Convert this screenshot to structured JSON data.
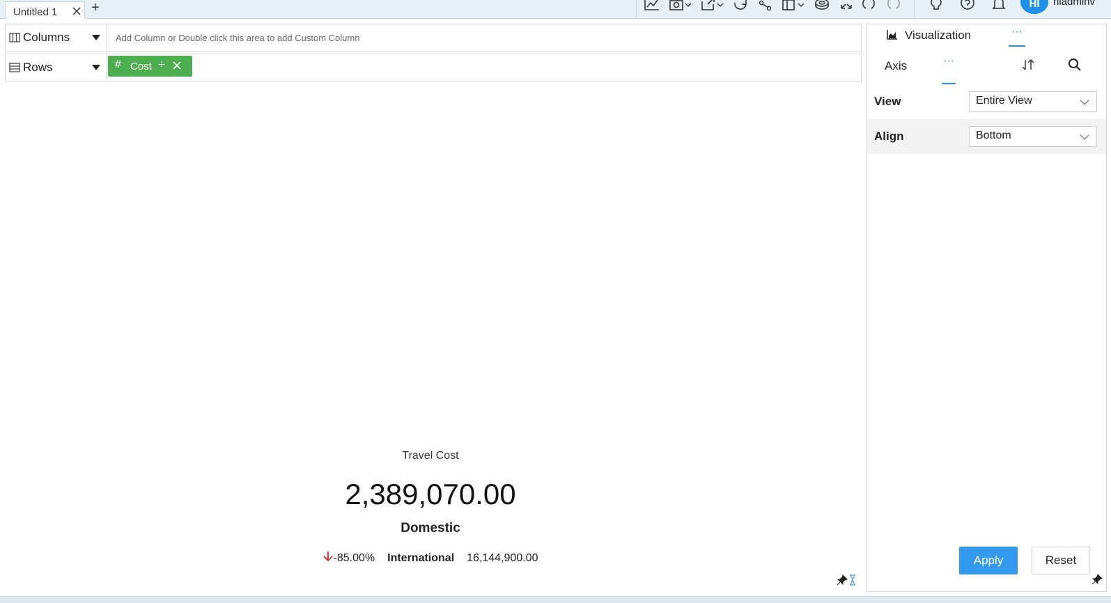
{
  "tabs": [
    {
      "title": "Untitled 1"
    }
  ],
  "tab_add_label": "+",
  "toolbar": {
    "icons": [
      "chart-icon",
      "camera-icon",
      "export-icon",
      "refresh-icon",
      "share-icon",
      "layout-icon",
      "database-icon",
      "expand-icon",
      "undo-icon",
      "redo-icon",
      "bulb-icon",
      "help-icon",
      "bell-icon"
    ]
  },
  "user": {
    "initials": "HI",
    "name": "hiadminv"
  },
  "shelves": {
    "columns": {
      "label": "Columns",
      "hint": "Add Column or Double click this area to add Custom Column"
    },
    "rows": {
      "label": "Rows",
      "pill": {
        "label": "Cost",
        "hash": "#",
        "divider": "÷"
      }
    }
  },
  "kpi": {
    "title": "Travel Cost",
    "value": "2,389,070.00",
    "label": "Domestic",
    "change": "-85.00%",
    "compare_label": "International",
    "compare_value": "16,144,900.00"
  },
  "panel": {
    "title": "Visualization",
    "more": "···",
    "subtabs": {
      "axis": "Axis",
      "more": "···"
    },
    "properties": [
      {
        "label": "View",
        "value": "Entire View"
      },
      {
        "label": "Align",
        "value": "Bottom"
      }
    ],
    "apply_label": "Apply",
    "reset_label": "Reset"
  },
  "colors": {
    "accent": "#1f8fe8",
    "pill": "#4cae4f",
    "negative": "#e02424",
    "apply": "#3399ee"
  }
}
